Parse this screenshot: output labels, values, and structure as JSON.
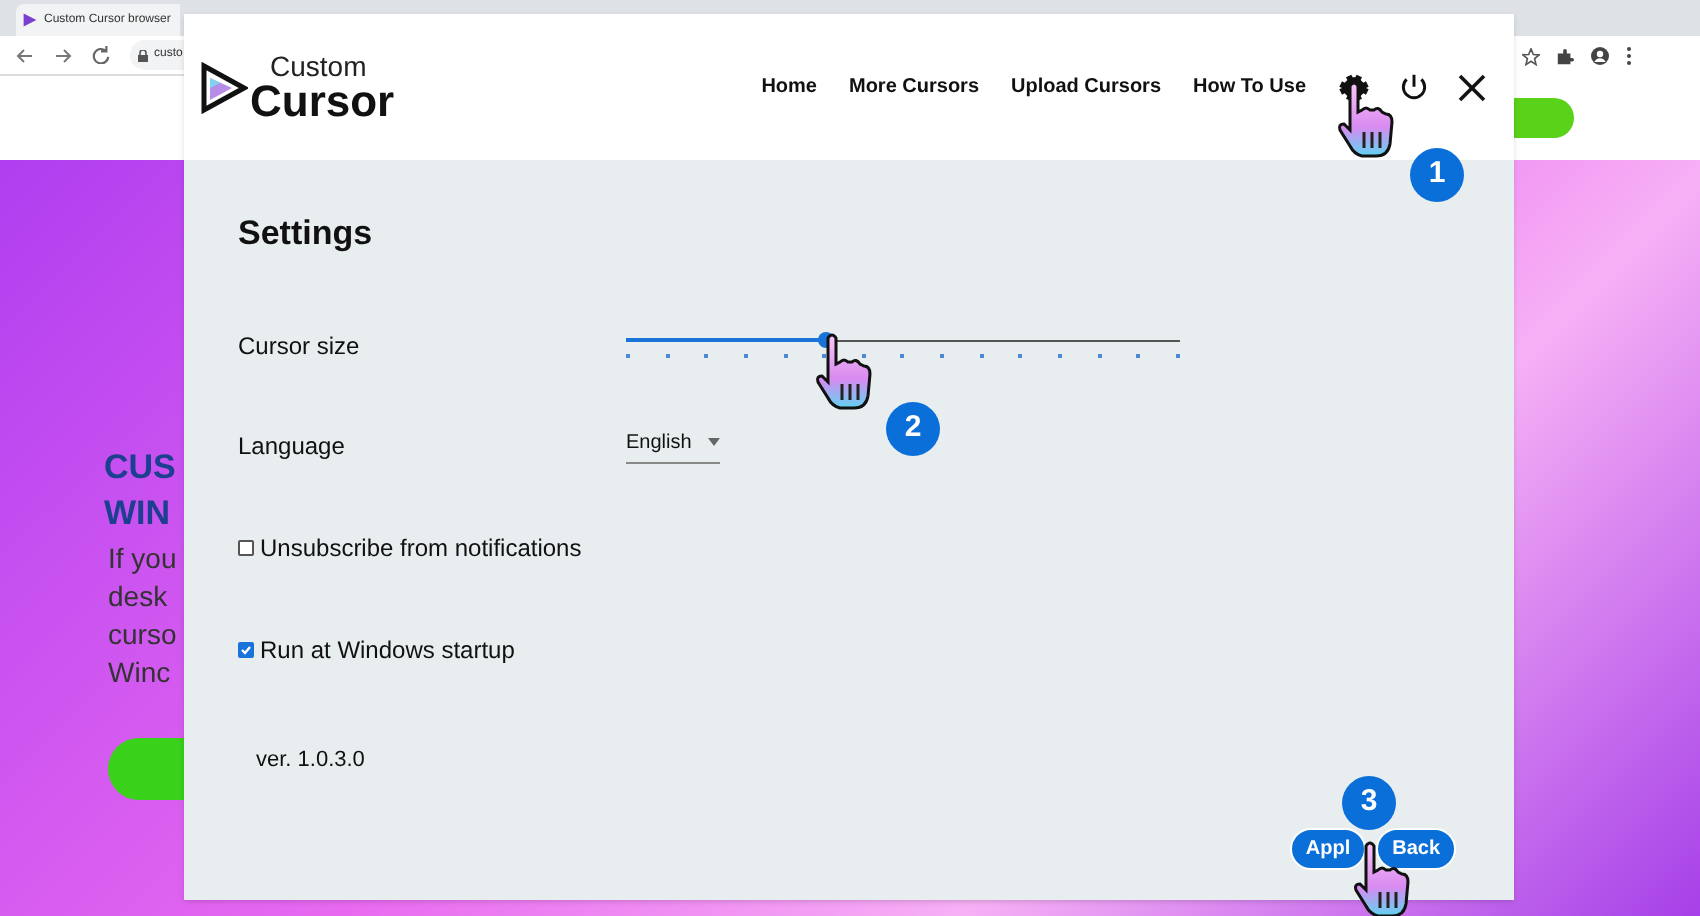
{
  "browser": {
    "tab_title": "Custom Cursor browser",
    "address": "custo"
  },
  "background_page": {
    "headline": [
      "CUS",
      "WIN"
    ],
    "paragraph": [
      "If you",
      "desk",
      "curso",
      "Winc"
    ]
  },
  "app": {
    "logo_top": "Custom",
    "logo_bottom": "Cursor",
    "nav": [
      "Home",
      "More Cursors",
      "Upload Cursors",
      "How To Use"
    ]
  },
  "settings": {
    "title": "Settings",
    "cursor_size": {
      "label": "Cursor size",
      "level": 0.36
    },
    "language": {
      "label": "Language",
      "value": "English"
    },
    "options": [
      {
        "label": "Unsubscribe from notifications",
        "checked": false
      },
      {
        "label": "Run at Windows startup",
        "checked": true
      }
    ],
    "version": "ver. 1.0.3.0",
    "buttons": [
      "Appl",
      "Back"
    ]
  },
  "callouts": [
    "1",
    "2",
    "3"
  ]
}
